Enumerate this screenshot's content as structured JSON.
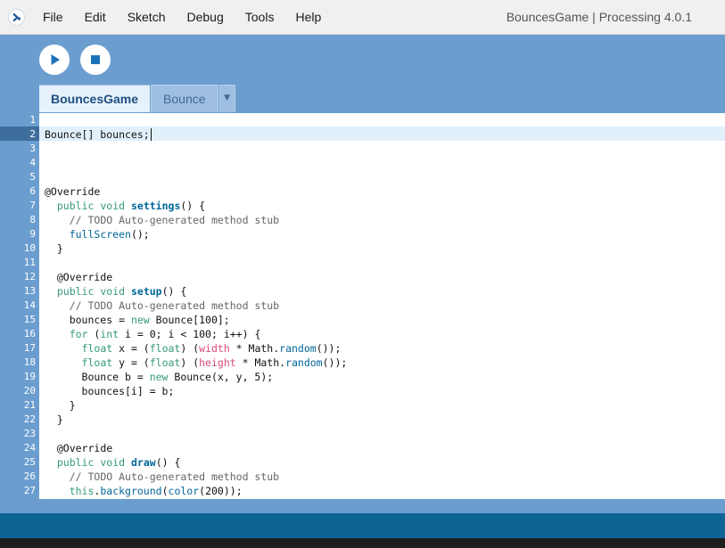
{
  "menubar": {
    "items": [
      "File",
      "Edit",
      "Sketch",
      "Debug",
      "Tools",
      "Help"
    ],
    "window_title": "BouncesGame | Processing 4.0.1"
  },
  "toolbar": {
    "run_icon": "play-icon",
    "stop_icon": "stop-icon"
  },
  "tabs": [
    {
      "label": "BouncesGame",
      "active": true
    },
    {
      "label": "Bounce",
      "active": false
    }
  ],
  "tab_menu_icon": "chevron-down-icon",
  "editor": {
    "current_line": 2,
    "lines": [
      "",
      "Bounce[] bounces;",
      "",
      "",
      "",
      "@Override",
      "  public void settings() {",
      "    // TODO Auto-generated method stub",
      "    fullScreen();",
      "  }",
      "",
      "  @Override",
      "  public void setup() {",
      "    // TODO Auto-generated method stub",
      "    bounces = new Bounce[100];",
      "    for (int i = 0; i < 100; i++) {",
      "      float x = (float) (width * Math.random());",
      "      float y = (float) (height * Math.random());",
      "      Bounce b = new Bounce(x, y, 5);",
      "      bounces[i] = b;",
      "    }",
      "  }",
      "",
      "  @Override",
      "  public void draw() {",
      "    // TODO Auto-generated method stub",
      "    this.background(color(200));"
    ]
  },
  "colors": {
    "toolbar_bg": "#6b9ecf",
    "status_bar": "#0f6496",
    "keyword": "#33997e",
    "function": "#006699",
    "variable": "#d94a7a",
    "comment": "#666666"
  }
}
